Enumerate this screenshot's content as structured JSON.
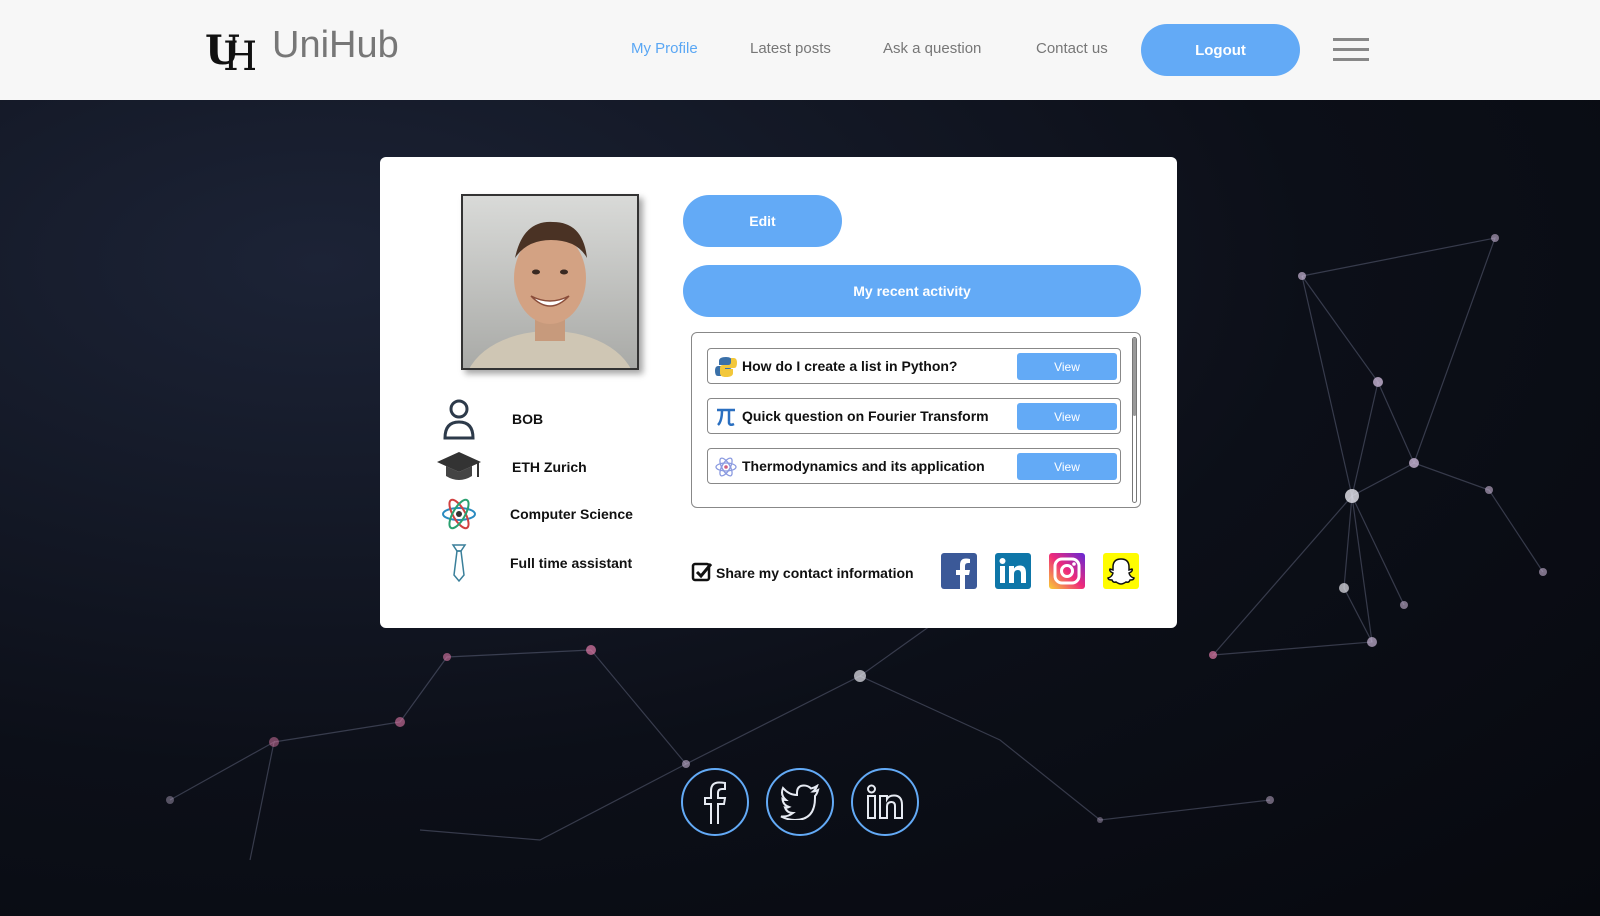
{
  "header": {
    "logo_text": "UniHub",
    "nav": [
      {
        "label": "My Profile",
        "active": true
      },
      {
        "label": "Latest posts",
        "active": false
      },
      {
        "label": "Ask a question",
        "active": false
      },
      {
        "label": "Contact us",
        "active": false
      }
    ],
    "logout_label": "Logout"
  },
  "profile": {
    "name": "BOB",
    "university": "ETH Zurich",
    "field": "Computer Science",
    "position": "Full time assistant"
  },
  "actions": {
    "edit_label": "Edit",
    "activity_label": "My recent activity"
  },
  "activity": {
    "items": [
      {
        "title": "How do I create a list in Python?",
        "icon": "python-icon",
        "button": "View"
      },
      {
        "title": "Quick question on Fourier Transform",
        "icon": "pi-icon",
        "button": "View"
      },
      {
        "title": "Thermodynamics and its application",
        "icon": "atom-icon",
        "button": "View"
      }
    ]
  },
  "share": {
    "label": "Share my contact information",
    "checked": true
  },
  "contact_socials": [
    "facebook-icon",
    "linkedin-icon",
    "instagram-icon",
    "snapchat-icon"
  ],
  "footer_socials": [
    "facebook-icon",
    "twitter-icon",
    "linkedin-icon"
  ],
  "colors": {
    "accent": "#63aaf6",
    "nav_active": "#5aa7f4",
    "facebook": "#3b5998",
    "linkedin": "#0e76a8",
    "snapchat": "#fffc00"
  }
}
